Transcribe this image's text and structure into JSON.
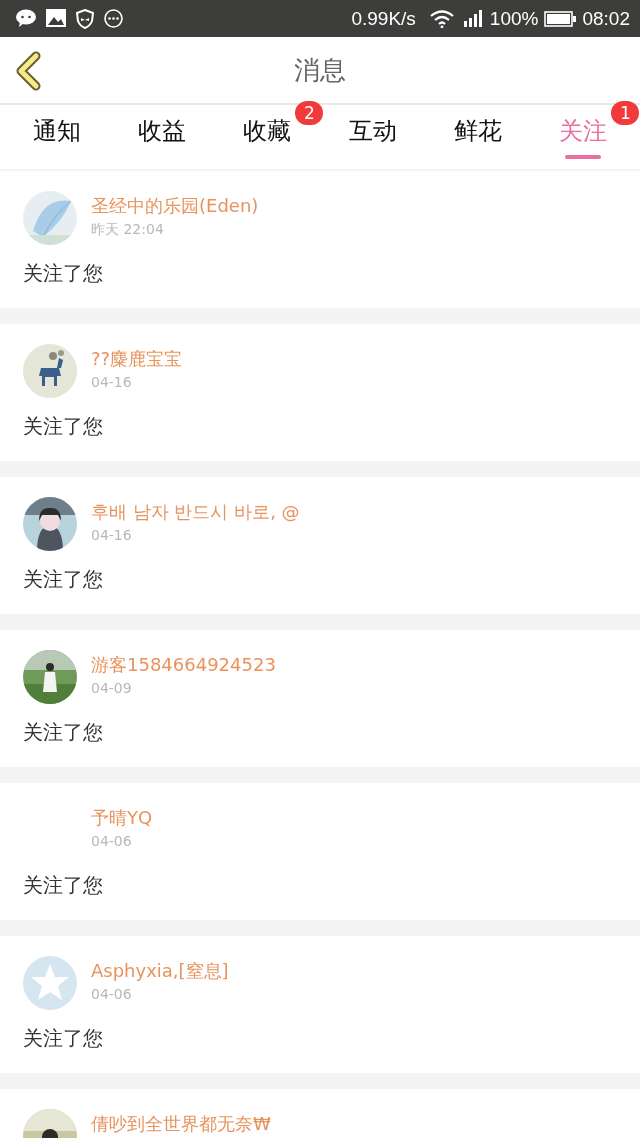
{
  "status_bar": {
    "speed": "0.99K/s",
    "battery": "100%",
    "time": "08:02"
  },
  "header": {
    "title": "消息"
  },
  "tabs": [
    {
      "label": "通知",
      "selected": false
    },
    {
      "label": "收益",
      "selected": false
    },
    {
      "label": "收藏",
      "selected": false,
      "badge": "2"
    },
    {
      "label": "互动",
      "selected": false
    },
    {
      "label": "鲜花",
      "selected": false
    },
    {
      "label": "关注",
      "selected": true,
      "badge": "1"
    }
  ],
  "messages": [
    {
      "name": "圣经中的乐园(Eden)",
      "time": "昨天 22:04",
      "text": "关注了您",
      "kind": "picture"
    },
    {
      "name": "??麋鹿宝宝",
      "time": "04-16",
      "text": "关注了您",
      "kind": "picture"
    },
    {
      "name": "후배 남자 반드시 바로, @",
      "time": "04-16",
      "text": "关注了您",
      "kind": "picture"
    },
    {
      "name": "游客1584664924523",
      "time": "04-09",
      "text": "关注了您",
      "kind": "picture"
    },
    {
      "name": "予晴YQ",
      "time": "04-06",
      "text": "关注了您"
    },
    {
      "name": "Asphyxia,[窒息]",
      "time": "04-06",
      "text": "关注了您",
      "kind": "default"
    },
    {
      "name": "倩吵到全世界都无奈₩",
      "kind": "picture"
    }
  ]
}
